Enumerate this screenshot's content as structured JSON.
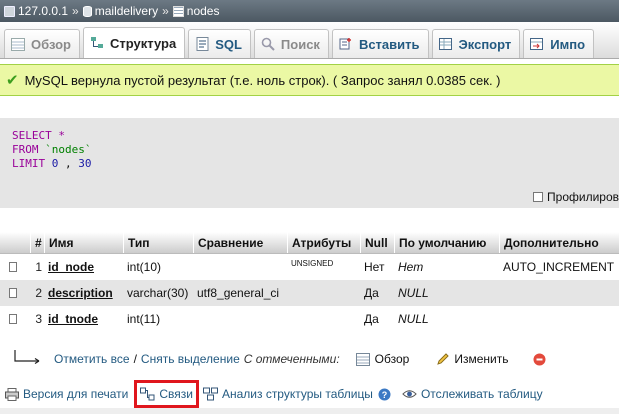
{
  "breadcrumb": {
    "server": "127.0.0.1",
    "separator": "»",
    "database": "maildelivery",
    "table": "nodes"
  },
  "tabs": [
    {
      "label": "Обзор",
      "icon": "browse-icon",
      "state": "disabled"
    },
    {
      "label": "Структура",
      "icon": "structure-icon",
      "state": "active"
    },
    {
      "label": "SQL",
      "icon": "sql-icon",
      "state": "normal"
    },
    {
      "label": "Поиск",
      "icon": "search-icon",
      "state": "disabled"
    },
    {
      "label": "Вставить",
      "icon": "insert-icon",
      "state": "normal"
    },
    {
      "label": "Экспорт",
      "icon": "export-icon",
      "state": "normal"
    },
    {
      "label": "Импо",
      "icon": "import-icon",
      "state": "normal"
    }
  ],
  "message": {
    "text": "MySQL вернула пустой результат (т.е. ноль строк). ( Запрос занял 0.0385 сек. )"
  },
  "sql": {
    "select_kw": "SELECT",
    "select_rest": " *",
    "from_kw": "FROM",
    "from_table": "`nodes`",
    "limit_kw": "LIMIT",
    "limit_a": "0",
    "limit_sep": " , ",
    "limit_b": "30"
  },
  "profile_label": "Профилиров",
  "table": {
    "headers": [
      "#",
      "Имя",
      "Тип",
      "Сравнение",
      "Атрибуты",
      "Null",
      "По умолчанию",
      "Дополнительно"
    ],
    "rows": [
      {
        "num": "1",
        "name": "id_node",
        "type": "int(10)",
        "collation": "",
        "attributes": "UNSIGNED",
        "null": "Нет",
        "default": "Нет",
        "extra": "AUTO_INCREMENT"
      },
      {
        "num": "2",
        "name": "description",
        "type": "varchar(30)",
        "collation": "utf8_general_ci",
        "attributes": "",
        "null": "Да",
        "default": "NULL",
        "extra": ""
      },
      {
        "num": "3",
        "name": "id_tnode",
        "type": "int(11)",
        "collation": "",
        "attributes": "",
        "null": "Да",
        "default": "NULL",
        "extra": ""
      }
    ]
  },
  "actions": {
    "check_all": "Отметить все",
    "divider": "/",
    "uncheck_all": "Снять выделение",
    "with_selected": "С отмеченными:",
    "browse": "Обзор",
    "change": "Изменить"
  },
  "bottom_links": {
    "print_view": "Версия для печати",
    "relations": "Связи",
    "analyze": "Анализ структуры таблицы",
    "track": "Отслеживать таблицу"
  },
  "colors": {
    "highlight_box": "#e0161d",
    "success_bg": "#ebf8a4",
    "success_border": "#a2d246",
    "keyword": "#990099",
    "string": "#008000",
    "link": "#235a81"
  }
}
